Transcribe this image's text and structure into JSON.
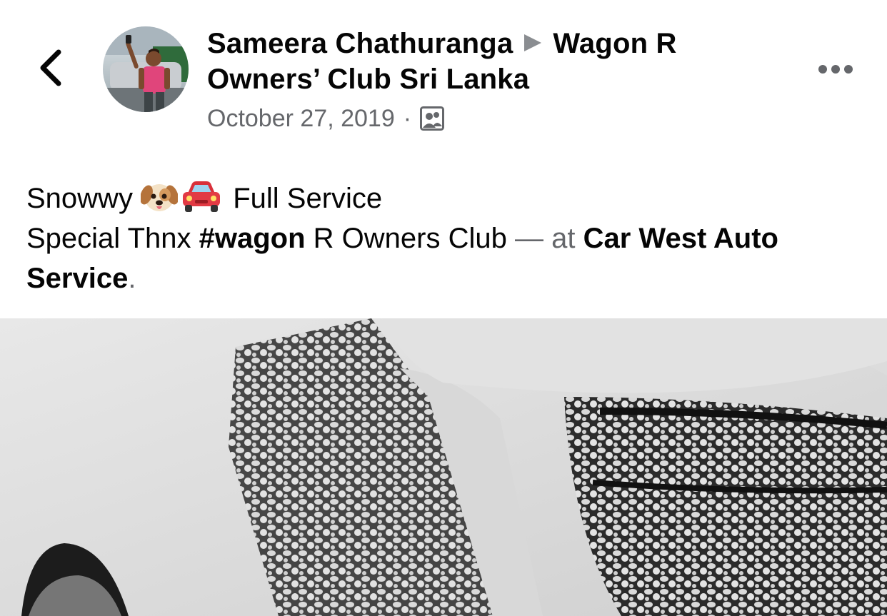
{
  "header": {
    "author": "Sameera Chathuranga",
    "group": "Wagon R Owners’ Club Sri Lanka",
    "date": "October 27, 2019",
    "separator": "·",
    "audience_icon": "group-photo-icon"
  },
  "post": {
    "line1_text1": "Snowwy",
    "line1_emojis": [
      "dog-face-emoji",
      "car-emoji"
    ],
    "line1_text2": "Full Service",
    "line2_text1": "Special Thnx",
    "line2_hashtag": "#wagon",
    "line2_text2": "R Owners Club",
    "line2_at": "— at",
    "location_part1": "Car West Auto",
    "location_part2": "Service",
    "period": "."
  },
  "icons": {
    "back": "chevron-left-icon",
    "more": "more-horizontal-icon",
    "arrow": "triangle-right-icon"
  }
}
